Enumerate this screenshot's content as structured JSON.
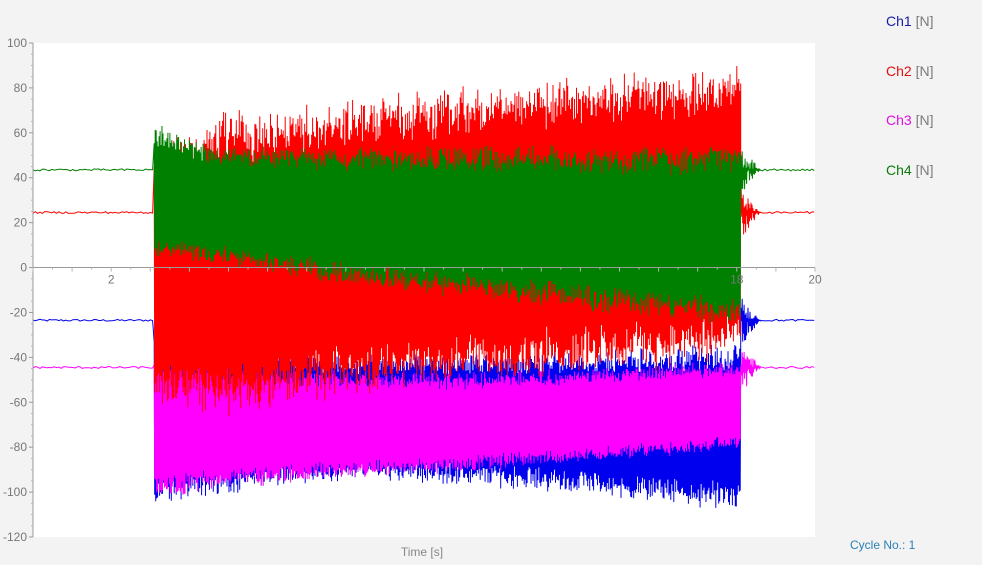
{
  "chart_data": {
    "type": "line",
    "title": "",
    "xlabel": "Time [s]",
    "ylabel": "",
    "xlim": [
      0,
      20
    ],
    "ylim": [
      -120,
      100
    ],
    "grid": false,
    "legend_position": "top-right",
    "x_ticks": [
      {
        "value": 2,
        "label": "2"
      },
      {
        "value": 18,
        "label": "18"
      },
      {
        "value": 20,
        "label": "20"
      }
    ],
    "y_ticks": [
      100,
      80,
      60,
      40,
      20,
      0,
      -20,
      -40,
      -60,
      -80,
      -100,
      -120
    ],
    "active_interval_s": [
      3.1,
      18.1
    ],
    "series": [
      {
        "name": "Ch1",
        "unit": "[N]",
        "color": "#0000ee",
        "baseline": -23.5,
        "envelope": [
          {
            "x": 3.1,
            "low": -104,
            "high": -32
          },
          {
            "x": 5.0,
            "low": -99,
            "high": -36
          },
          {
            "x": 8.0,
            "low": -93,
            "high": -40
          },
          {
            "x": 11.0,
            "low": -95,
            "high": -40
          },
          {
            "x": 14.0,
            "low": -99,
            "high": -39
          },
          {
            "x": 16.5,
            "low": -104,
            "high": -37
          },
          {
            "x": 18.0,
            "low": -107,
            "high": -35
          }
        ]
      },
      {
        "name": "Ch2",
        "unit": "[N]",
        "color": "#ff0000",
        "baseline": 24.5,
        "envelope": [
          {
            "x": 3.1,
            "low": -58,
            "high": 50
          },
          {
            "x": 5.0,
            "low": -62,
            "high": 66
          },
          {
            "x": 8.0,
            "low": -54,
            "high": 71
          },
          {
            "x": 11.0,
            "low": -49,
            "high": 77
          },
          {
            "x": 14.0,
            "low": -44,
            "high": 81
          },
          {
            "x": 16.5,
            "low": -41,
            "high": 84
          },
          {
            "x": 18.0,
            "low": -38,
            "high": 87
          }
        ]
      },
      {
        "name": "Ch3",
        "unit": "[N]",
        "color": "#ff00ff",
        "baseline": -44.5,
        "envelope": [
          {
            "x": 3.1,
            "low": -103,
            "high": -38
          },
          {
            "x": 5.0,
            "low": -97,
            "high": -44
          },
          {
            "x": 8.0,
            "low": -93,
            "high": -47
          },
          {
            "x": 11.0,
            "low": -90,
            "high": -48
          },
          {
            "x": 14.0,
            "low": -86,
            "high": -46
          },
          {
            "x": 16.5,
            "low": -83,
            "high": -44
          },
          {
            "x": 18.0,
            "low": -80,
            "high": -43
          }
        ]
      },
      {
        "name": "Ch4",
        "unit": "[N]",
        "color": "#008000",
        "baseline": 43.5,
        "envelope": [
          {
            "x": 3.1,
            "low": 5,
            "high": 62
          },
          {
            "x": 5.0,
            "low": 2,
            "high": 52
          },
          {
            "x": 8.0,
            "low": -6,
            "high": 52
          },
          {
            "x": 11.0,
            "low": -12,
            "high": 52
          },
          {
            "x": 14.0,
            "low": -17,
            "high": 52
          },
          {
            "x": 16.5,
            "low": -21,
            "high": 52
          },
          {
            "x": 18.0,
            "low": -25,
            "high": 54
          }
        ]
      }
    ]
  },
  "legend": [
    {
      "name": "Ch1",
      "unit": "[N]",
      "color": "#1a1aa6"
    },
    {
      "name": "Ch2",
      "unit": "[N]",
      "color": "#e01010"
    },
    {
      "name": "Ch3",
      "unit": "[N]",
      "color": "#e010e0"
    },
    {
      "name": "Ch4",
      "unit": "[N]",
      "color": "#0a7a0a"
    }
  ],
  "footer": {
    "cycle_label": "Cycle No.: 1"
  }
}
